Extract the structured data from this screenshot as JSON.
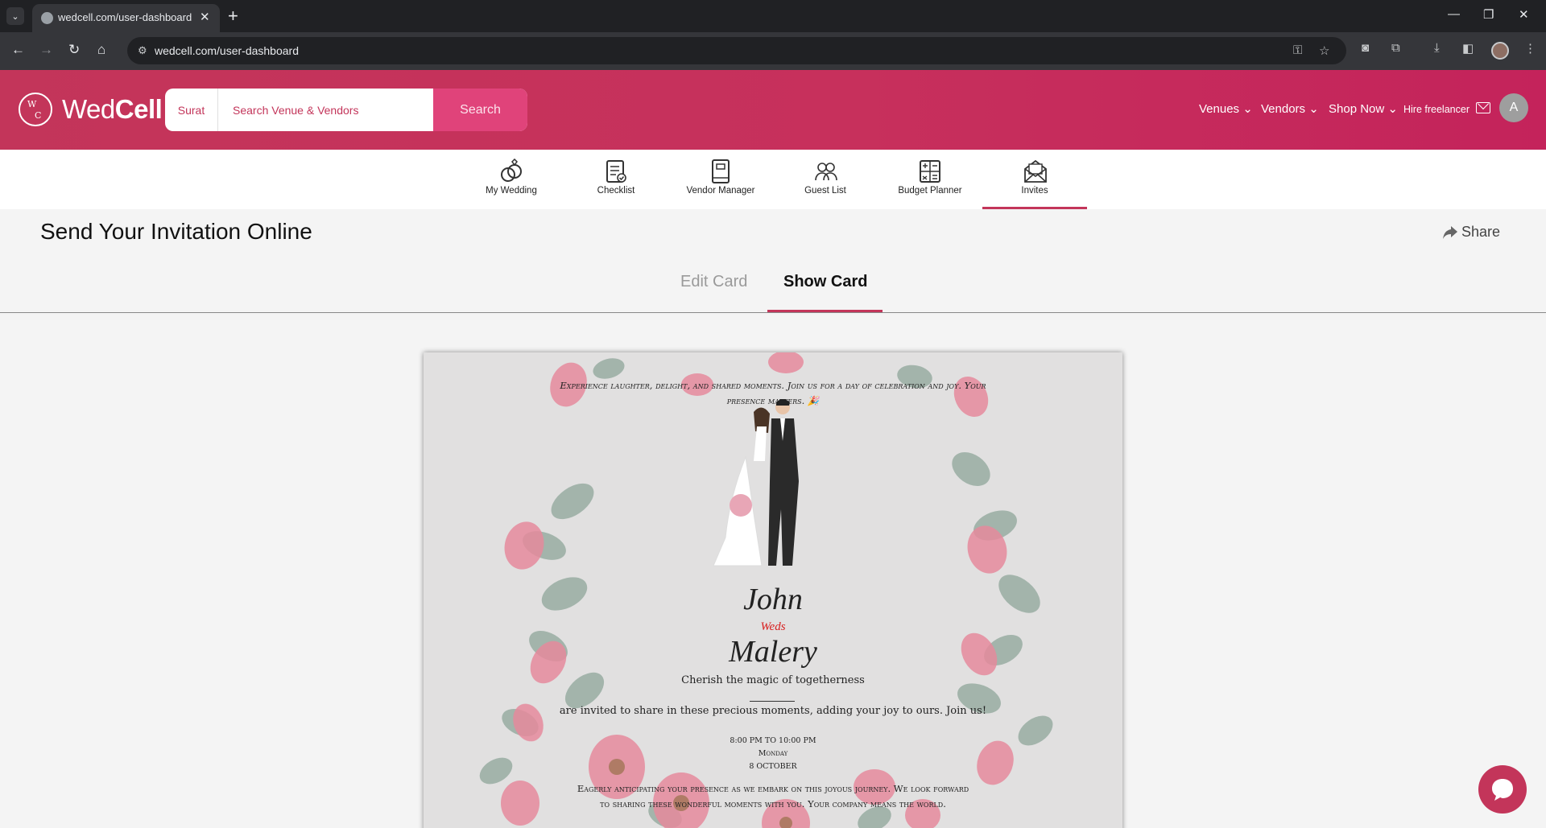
{
  "browser": {
    "tab_title": "wedcell.com/user-dashboard",
    "url": "wedcell.com/user-dashboard",
    "tab_menu_icon": "chevron-down-icon",
    "close_glyph": "✕",
    "newtab_glyph": "+",
    "minimize_glyph": "—",
    "restore_glyph": "❐",
    "closewin_glyph": "✕",
    "back_glyph": "←",
    "forward_glyph": "→",
    "reload_glyph": "↻",
    "home_glyph": "⌂",
    "site_info_glyph": "⚙",
    "key_glyph": "⚿",
    "star_glyph": "☆",
    "camera_glyph": "◙",
    "extensions_glyph": "⧉",
    "download_glyph": "⤓",
    "sidepanel_glyph": "◧",
    "menu_glyph": "⋮"
  },
  "header": {
    "brand_part1": "Wed",
    "brand_part2": "Cell",
    "logo_w": "W",
    "logo_c": "C",
    "city": "Surat",
    "search_placeholder": "Search Venue & Vendors",
    "search_button": "Search",
    "nav": [
      "Venues ⌄",
      "Vendors ⌄",
      "Shop Now ⌄",
      "Hire freelancer"
    ],
    "avatar_letter": "A"
  },
  "dashboard_nav": {
    "items": [
      {
        "label": "My Wedding",
        "icon": "rings-icon"
      },
      {
        "label": "Checklist",
        "icon": "checklist-icon"
      },
      {
        "label": "Vendor Manager",
        "icon": "notebook-icon"
      },
      {
        "label": "Guest List",
        "icon": "guests-icon"
      },
      {
        "label": "Budget Planner",
        "icon": "calculator-icon"
      },
      {
        "label": "Invites",
        "icon": "envelope-icon"
      }
    ],
    "active": "Invites"
  },
  "page": {
    "title": "Send Your Invitation Online",
    "share_label": "Share",
    "tabs": [
      "Edit Card",
      "Show Card"
    ],
    "active_tab": "Show Card"
  },
  "card": {
    "intro": "Experience laughter, delight, and shared moments. Join us for a day of celebration and joy. Your presence matters. 🎉",
    "name1": "John",
    "weds": "Weds",
    "name2": "Malery",
    "tagline": "Cherish the magic of togetherness",
    "invite_line": "are invited to share in these precious moments, adding your joy to ours. Join us!",
    "time": "8:00 PM TO 10:00 PM",
    "day": "Monday",
    "date": "8 OCTOBER",
    "outro": "Eagerly anticipating your presence as we embark on this joyous journey. We look forward to sharing these wonderful moments with you. Your company means the world.",
    "accent_color": "#d82020",
    "petal_color": "#e58a9c",
    "leaf_color": "#8ea69a"
  },
  "colors": {
    "brand": "#c3355a",
    "search_button": "#e0437a"
  }
}
